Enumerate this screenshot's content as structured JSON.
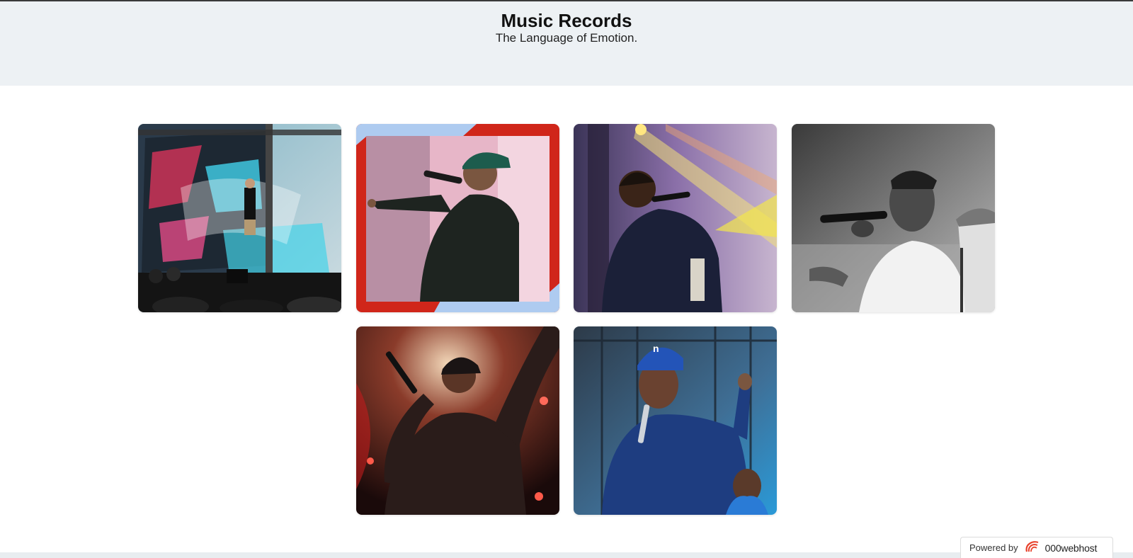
{
  "header": {
    "title": "Music Records",
    "tagline": "The Language of Emotion."
  },
  "gallery": {
    "items": [
      {
        "name": "concert-stage-photo"
      },
      {
        "name": "rapper-green-cap-photo"
      },
      {
        "name": "singer-purple-lights-photo"
      },
      {
        "name": "singer-black-white-photo"
      },
      {
        "name": "rapper-red-lights-photo"
      },
      {
        "name": "rapper-blue-jacket-photo"
      }
    ]
  },
  "footer": {
    "powered_label": "Powered by",
    "brand_label": "000webhost",
    "brand_icon": "000webhost-logo-icon"
  },
  "colors": {
    "header_bg": "#edf1f4",
    "brand_red": "#e8432d"
  }
}
